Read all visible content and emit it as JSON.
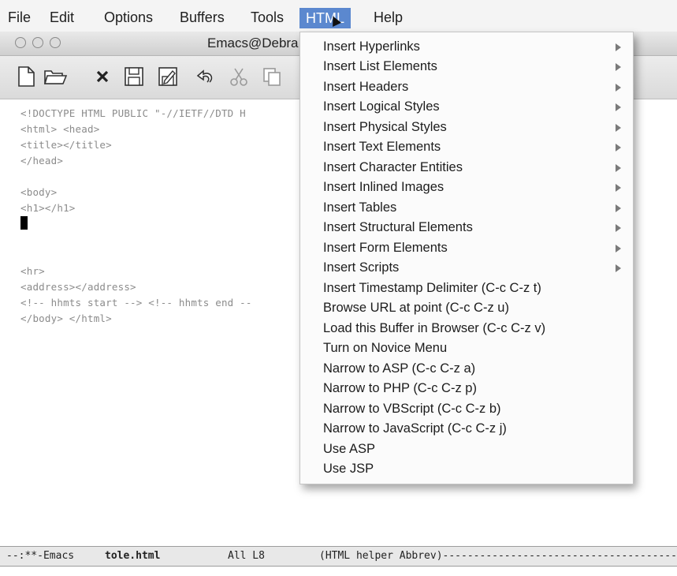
{
  "menubar": {
    "items": [
      "File",
      "Edit",
      "Options",
      "Buffers",
      "Tools",
      "HTML",
      "Help"
    ],
    "active": "HTML"
  },
  "window": {
    "title": "Emacs@Debra"
  },
  "toolbar": {
    "icons": [
      "new-file-icon",
      "open-folder-icon",
      "close-icon",
      "save-icon",
      "save-as-icon",
      "undo-icon",
      "cut-icon",
      "copy-icon"
    ]
  },
  "editor": {
    "lines": [
      "<!DOCTYPE HTML PUBLIC \"-//IETF//DTD H",
      "<html> <head>",
      "<title></title>",
      "</head>",
      "",
      "<body>",
      "<h1></h1>",
      "",
      "",
      "",
      "<hr>",
      "<address></address>",
      "<!-- hhmts start --> <!-- hhmts end --",
      "</body> </html>"
    ]
  },
  "html_menu": {
    "items": [
      {
        "label": "Insert Hyperlinks",
        "submenu": true
      },
      {
        "label": "Insert List Elements",
        "submenu": true
      },
      {
        "label": "Insert Headers",
        "submenu": true
      },
      {
        "label": "Insert Logical Styles",
        "submenu": true
      },
      {
        "label": "Insert Physical Styles",
        "submenu": true
      },
      {
        "label": "Insert Text Elements",
        "submenu": true
      },
      {
        "label": "Insert Character Entities",
        "submenu": true
      },
      {
        "label": "Insert Inlined Images",
        "submenu": true
      },
      {
        "label": "Insert Tables",
        "submenu": true
      },
      {
        "label": "Insert Structural Elements",
        "submenu": true
      },
      {
        "label": "Insert Form Elements",
        "submenu": true
      },
      {
        "label": "Insert Scripts",
        "submenu": true
      },
      {
        "label": "Insert Timestamp Delimiter   (C-c C-z t)",
        "submenu": false
      },
      {
        "label": "Browse URL at point   (C-c C-z u)",
        "submenu": false
      },
      {
        "label": "Load this Buffer in Browser   (C-c C-z v)",
        "submenu": false
      },
      {
        "label": "Turn on Novice Menu",
        "submenu": false
      },
      {
        "label": "Narrow to ASP   (C-c C-z a)",
        "submenu": false
      },
      {
        "label": "Narrow to PHP   (C-c C-z p)",
        "submenu": false
      },
      {
        "label": "Narrow to VBScript   (C-c C-z b)",
        "submenu": false
      },
      {
        "label": "Narrow to JavaScript   (C-c C-z j)",
        "submenu": false
      },
      {
        "label": "Use ASP",
        "submenu": false
      },
      {
        "label": "Use JSP",
        "submenu": false
      }
    ]
  },
  "modeline": {
    "status": "--:**-Emacs",
    "buffer": "tole.html",
    "position": "All L8",
    "mode": "(HTML helper Abbrev)-----------------------------------------"
  },
  "colors": {
    "menu_highlight": "#5b88cf",
    "menubar_bg": "#f4f4f4",
    "dropdown_bg": "#fbfbfb"
  }
}
